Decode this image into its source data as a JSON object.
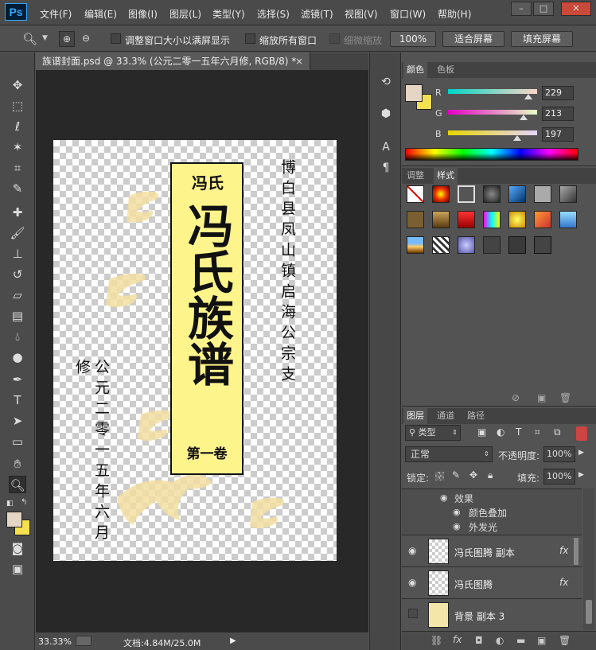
{
  "app": {
    "logo": "Ps",
    "menu": [
      "文件(F)",
      "编辑(E)",
      "图像(I)",
      "图层(L)",
      "类型(Y)",
      "选择(S)",
      "滤镜(T)",
      "视图(V)",
      "窗口(W)",
      "帮助(H)"
    ],
    "window_controls": [
      "–",
      "□",
      "✕"
    ]
  },
  "options": {
    "check1_label": "调整窗口大小以满屏显示",
    "check2_label": "缩放所有窗口",
    "check3_label": "细微缩放",
    "zoom_value": "100%",
    "fit_screen": "适合屏幕",
    "fill_screen": "填充屏幕"
  },
  "document": {
    "tab_title": "族谱封面.psd @ 33.3% (公元二零一五年六月修, RGB/8) *",
    "tab_close": "×",
    "box_top_text": "冯氏",
    "box_main_text": "冯氏族谱",
    "box_volume": "第一卷",
    "right_text": "博白县凤山镇启海公宗支",
    "left_text": "公元二零一五年六月修"
  },
  "status": {
    "zoom": "33.33%",
    "doc_info": "文档:4.84M/25.0M"
  },
  "color_panel": {
    "tabs": [
      "颜色",
      "色板"
    ],
    "fg_color": "#e5d5c5",
    "bg_color": "#f5e050",
    "channels": [
      {
        "label": "R",
        "value": "229"
      },
      {
        "label": "G",
        "value": "213"
      },
      {
        "label": "B",
        "value": "197"
      }
    ]
  },
  "styles_panel": {
    "tabs": [
      "调整",
      "样式"
    ]
  },
  "layers_panel": {
    "tabs": [
      "图层",
      "通道",
      "路径"
    ],
    "filter_kind": "类型",
    "blend_mode": "正常",
    "opacity_label": "不透明度:",
    "opacity_value": "100%",
    "lock_label": "锁定:",
    "fill_label": "填充:",
    "fill_value": "100%",
    "effects_label": "效果",
    "effect_items": [
      "颜色叠加",
      "外发光"
    ],
    "layers": [
      {
        "name": "冯氏图腾 副本",
        "fx": "fx"
      },
      {
        "name": "冯氏图腾",
        "fx": "fx"
      },
      {
        "name": "背景 副本 3",
        "fx": ""
      }
    ]
  }
}
